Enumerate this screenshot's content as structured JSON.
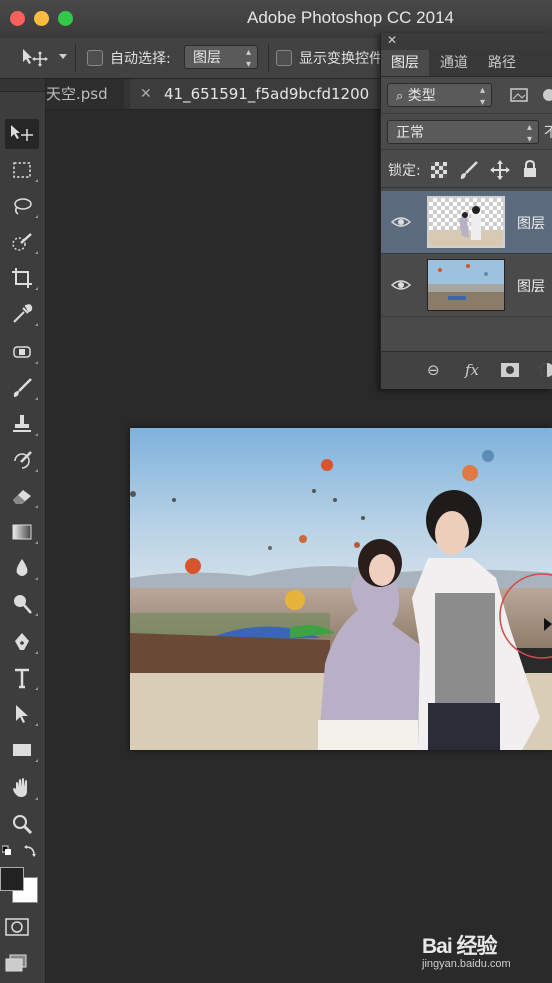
{
  "window": {
    "title": "Adobe Photoshop CC 2014"
  },
  "options_bar": {
    "auto_select_label": "自动选择:",
    "auto_select_value": "图层",
    "show_transform_label": "显示变换控件"
  },
  "tabs": [
    {
      "label": "天空.psd"
    },
    {
      "label": "41_651591_f5ad9bcfd1200"
    }
  ],
  "layers_panel": {
    "tabs": [
      "图层",
      "通道",
      "路径"
    ],
    "filter_kind": "类型",
    "blend_mode": "正常",
    "opacity_label_partial": "不",
    "lock_label": "锁定:",
    "layers": [
      {
        "name": "图层",
        "selected": true,
        "visible": true
      },
      {
        "name": "图层",
        "selected": false,
        "visible": true
      }
    ],
    "footer_icons": [
      "link-icon",
      "fx-icon",
      "mask-icon",
      "adjustment-icon"
    ]
  },
  "toolbar": {
    "tools": [
      "move",
      "marquee",
      "lasso",
      "quick-select",
      "crop",
      "eyedropper",
      "healing",
      "brush",
      "stamp",
      "history-brush",
      "eraser",
      "gradient",
      "blur",
      "dodge",
      "pen",
      "type",
      "path-select",
      "rectangle",
      "hand",
      "zoom"
    ]
  },
  "watermark": {
    "brand": "Bai 经验",
    "url": "jingyan.baidu.com"
  }
}
